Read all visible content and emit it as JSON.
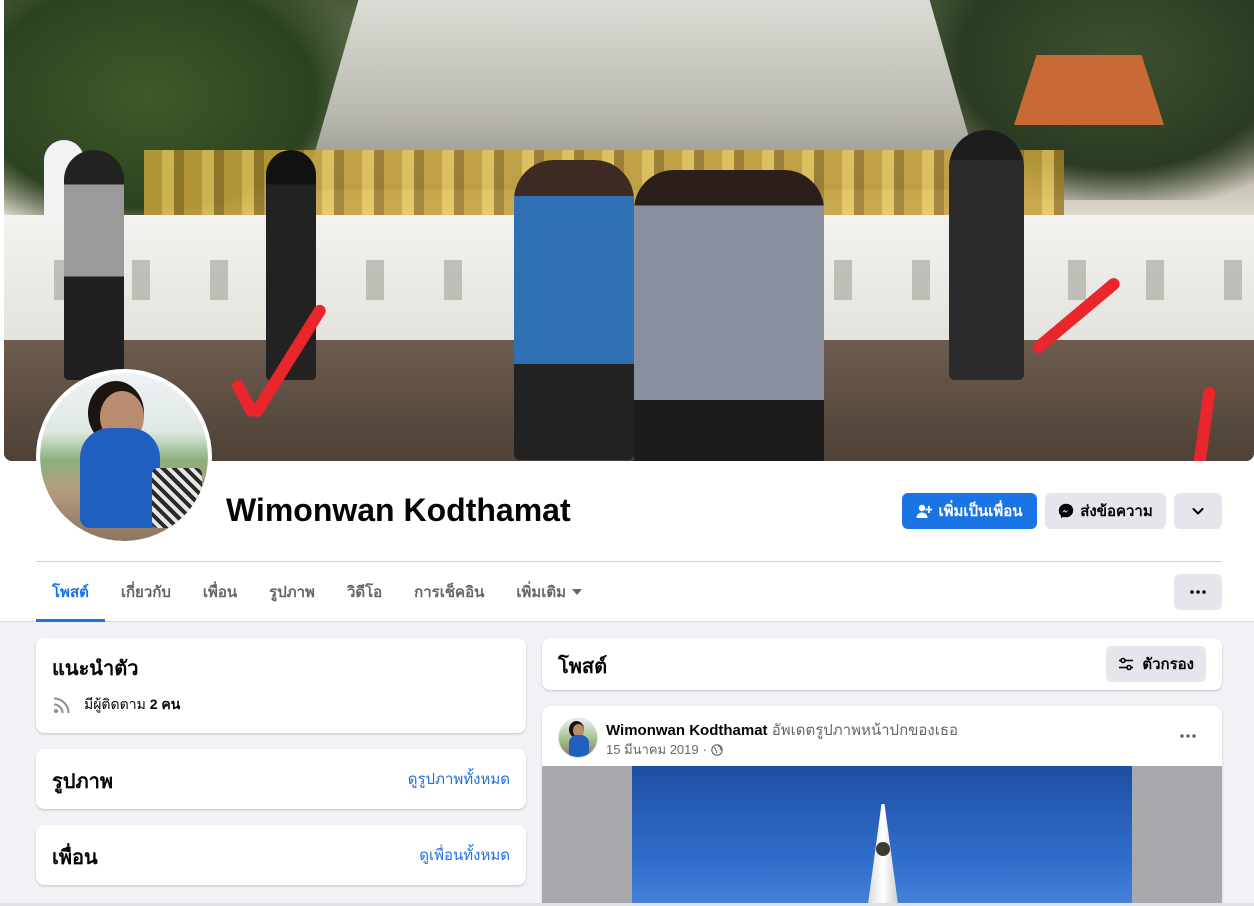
{
  "profile": {
    "name": "Wimonwan Kodthamat"
  },
  "actions": {
    "add_friend": "เพิ่มเป็นเพื่อน",
    "message": "ส่งข้อความ"
  },
  "tabs": [
    {
      "label": "โพสต์",
      "active": true
    },
    {
      "label": "เกี่ยวกับ",
      "active": false
    },
    {
      "label": "เพื่อน",
      "active": false
    },
    {
      "label": "รูปภาพ",
      "active": false
    },
    {
      "label": "วิดีโอ",
      "active": false
    },
    {
      "label": "การเช็คอิน",
      "active": false
    },
    {
      "label": "เพิ่มเติม",
      "active": false
    }
  ],
  "intro": {
    "title": "แนะนำตัว",
    "followers_prefix": "มีผู้ติดตาม",
    "followers_count": "2 คน"
  },
  "photos_card": {
    "title": "รูปภาพ",
    "link": "ดูรูปภาพทั้งหมด"
  },
  "friends_card": {
    "title": "เพื่อน",
    "link": "ดูเพื่อนทั้งหมด"
  },
  "posts": {
    "title": "โพสต์",
    "filter": "ตัวกรอง",
    "items": [
      {
        "author": "Wimonwan Kodthamat",
        "action": "อัพเดตรูปภาพหน้าปกของเธอ",
        "date": "15 มีนาคม 2019",
        "dot": "·"
      }
    ]
  },
  "colors": {
    "primary": "#1b74e4",
    "link": "#216fdb",
    "secondary_text": "#65676b",
    "background": "#f0f2f5"
  }
}
